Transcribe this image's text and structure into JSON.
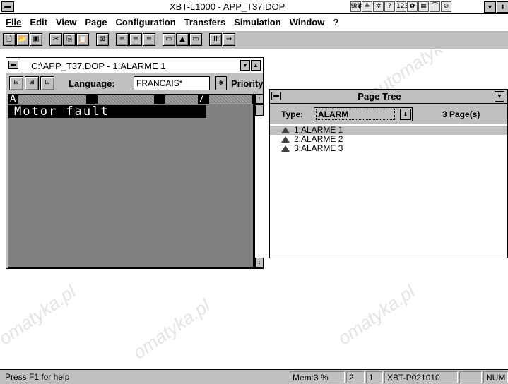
{
  "app": {
    "title": "XBT-L1000 - APP_T37.DOP"
  },
  "title_icons": [
    "𝕸𝕻",
    "≙",
    "✲",
    "?",
    "123",
    "✿",
    "▦",
    "⌒",
    "⊘"
  ],
  "menu": {
    "items": [
      {
        "label": "File"
      },
      {
        "label": "Edit"
      },
      {
        "label": "View"
      },
      {
        "label": "Page"
      },
      {
        "label": "Configuration"
      },
      {
        "label": "Transfers"
      },
      {
        "label": "Simulation"
      },
      {
        "label": "Window"
      },
      {
        "label": "?"
      }
    ]
  },
  "toolbar": {
    "buttons": [
      {
        "icon": "new-icon",
        "glyph": "🗋"
      },
      {
        "icon": "open-icon",
        "glyph": "📂"
      },
      {
        "icon": "save-icon",
        "glyph": "▣"
      },
      {
        "icon": "cut-icon",
        "glyph": "✂"
      },
      {
        "icon": "copy-icon",
        "glyph": "⎘"
      },
      {
        "icon": "paste-icon",
        "glyph": "📋"
      },
      {
        "icon": "delete-icon",
        "glyph": "⊠"
      },
      {
        "icon": "align-left-icon",
        "glyph": "≡"
      },
      {
        "icon": "align-center-icon",
        "glyph": "≡"
      },
      {
        "icon": "align-right-icon",
        "glyph": "≡"
      },
      {
        "icon": "field-icon",
        "glyph": "▭"
      },
      {
        "icon": "alarm-icon",
        "glyph": "▲"
      },
      {
        "icon": "page-icon",
        "glyph": "▭"
      },
      {
        "icon": "abc-icon",
        "glyph": "ⅡⅡ"
      },
      {
        "icon": "link-icon",
        "glyph": "→"
      }
    ]
  },
  "page_window": {
    "title": "C:\\APP_T37.DOP - 1:ALARME 1",
    "language_label": "Language:",
    "language_value": "FRANCAIS*",
    "priority_label": "Priority",
    "editor": {
      "line1_char": "A",
      "line1_slash": "/",
      "line2_text": "Motor fault"
    }
  },
  "page_tree": {
    "title": "Page Tree",
    "type_label": "Type:",
    "type_value": "ALARM",
    "pages_count": "3 Page(s)",
    "items": [
      {
        "label": "1:ALARME 1",
        "selected": true
      },
      {
        "label": "2:ALARME 2",
        "selected": false
      },
      {
        "label": "3:ALARME 3",
        "selected": false
      }
    ]
  },
  "watermark": {
    "text": "www.rgbautomatyka.pl",
    "short": "omatyka.pl"
  },
  "statusbar": {
    "help": "Press F1 for help",
    "mem": "Mem:3 %",
    "field1": "2",
    "field2": "1",
    "terminal": "XBT-P021010",
    "num": "NUM"
  }
}
